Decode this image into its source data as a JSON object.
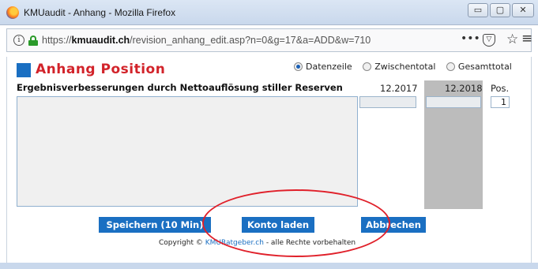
{
  "window": {
    "title": "KMUaudit - Anhang - Mozilla Firefox",
    "controls": {
      "minimize": "▭",
      "maximize": "▢",
      "close": "✕"
    }
  },
  "browser": {
    "url_prefix": "https://",
    "url_host": "kmuaudit.ch",
    "url_path": "/revision_anhang_edit.asp?n=0&g=17&a=ADD&w=710",
    "icons": {
      "info": "i",
      "more": "•••",
      "pocket": "▽",
      "bookmark": "☆",
      "menu": "≡"
    }
  },
  "page": {
    "title": "Anhang Position",
    "radio_options": [
      {
        "label": "Datenzeile",
        "selected": true
      },
      {
        "label": "Zwischentotal",
        "selected": false
      },
      {
        "label": "Gesamttotal",
        "selected": false
      }
    ],
    "row_heading": "Ergebnisverbesserungen durch Nettoauflösung stiller Reserven",
    "columns": {
      "year_prev": "12.2017",
      "year_curr": "12.2018",
      "pos": "Pos."
    },
    "fields": {
      "text_value": "",
      "value_2017": "",
      "value_2018": "",
      "pos_value": "1"
    },
    "buttons": {
      "save": "Speichern (10 Min)",
      "load": "Konto laden",
      "cancel": "Abbrechen"
    },
    "copyright": {
      "prefix": "Copyright © ",
      "link": "KMURatgeber.ch",
      "suffix": " - alle Rechte vorbehalten"
    }
  },
  "colors": {
    "accent": "#1a6fc2",
    "title_red": "#d2232a",
    "annotation_red": "#e0202a",
    "gray_column": "#bcbcbc"
  }
}
